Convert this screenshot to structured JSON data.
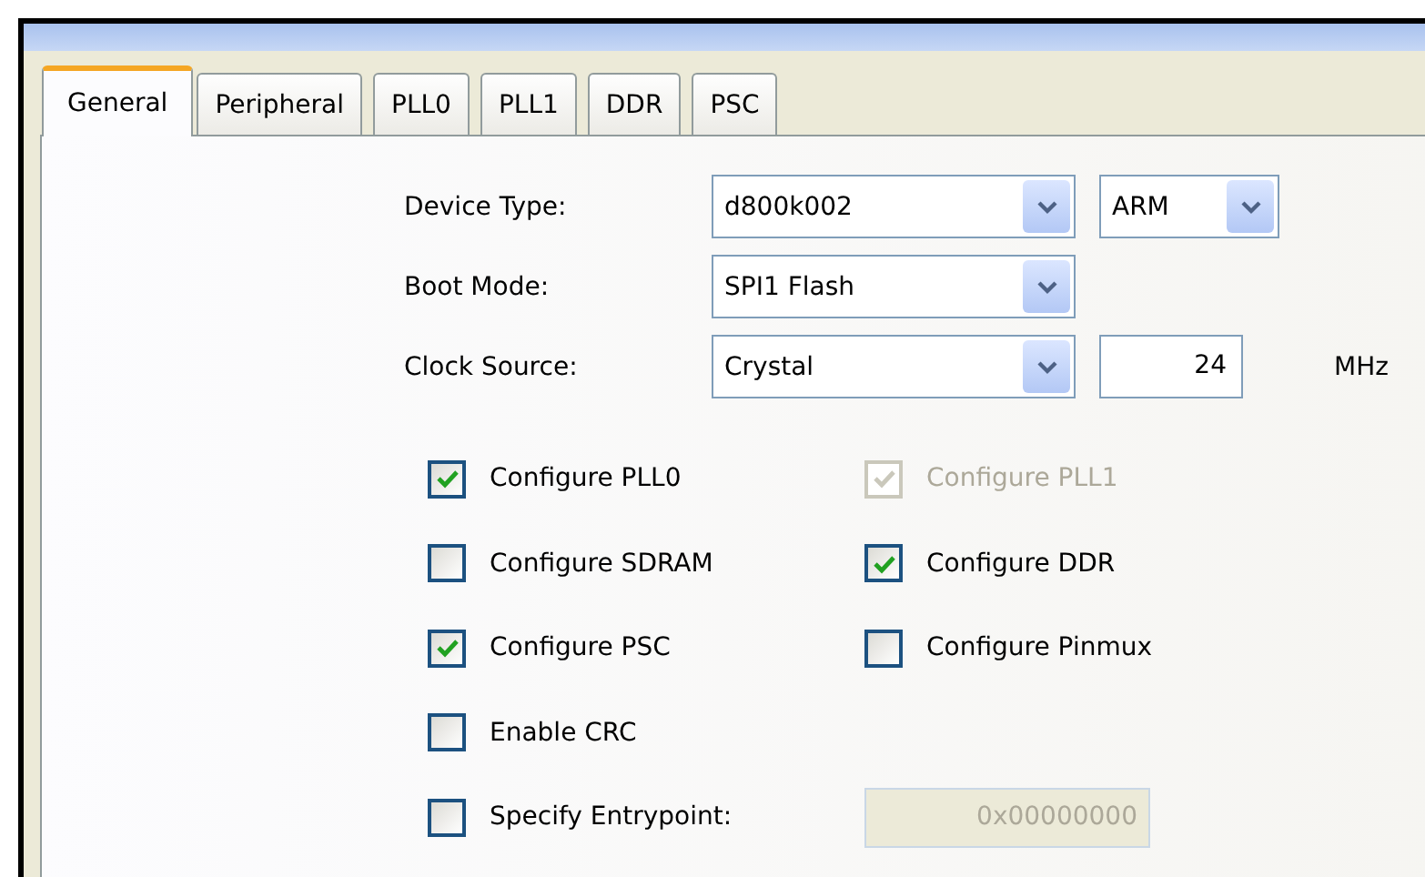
{
  "tabs": [
    {
      "label": "General",
      "selected": true
    },
    {
      "label": "Peripheral",
      "selected": false
    },
    {
      "label": "PLL0",
      "selected": false
    },
    {
      "label": "PLL1",
      "selected": false
    },
    {
      "label": "DDR",
      "selected": false
    },
    {
      "label": "PSC",
      "selected": false
    }
  ],
  "settings": [
    {
      "label": "Device Type:",
      "controls": [
        {
          "kind": "combo",
          "value": "d800k002"
        },
        {
          "kind": "combo",
          "value": "ARM"
        }
      ]
    },
    {
      "label": "Boot Mode:",
      "controls": [
        {
          "kind": "combo",
          "value": "SPI1 Flash"
        }
      ]
    },
    {
      "label": "Clock Source:",
      "controls": [
        {
          "kind": "combo",
          "value": "Crystal"
        },
        {
          "kind": "number",
          "value": "24"
        },
        {
          "kind": "unit",
          "value": "MHz"
        }
      ]
    }
  ],
  "option_rows": [
    [
      {
        "kind": "checkbox",
        "label": "Configure PLL0",
        "checked": true,
        "disabled": false
      },
      {
        "kind": "checkbox",
        "label": "Configure PLL1",
        "checked": true,
        "disabled": true
      }
    ],
    [
      {
        "kind": "checkbox",
        "label": "Configure SDRAM",
        "checked": false,
        "disabled": false
      },
      {
        "kind": "checkbox",
        "label": "Configure DDR",
        "checked": true,
        "disabled": false
      }
    ],
    [
      {
        "kind": "checkbox",
        "label": "Configure PSC",
        "checked": true,
        "disabled": false
      },
      {
        "kind": "checkbox",
        "label": "Configure Pinmux",
        "checked": false,
        "disabled": false
      }
    ],
    [
      {
        "kind": "checkbox",
        "label": "Enable CRC",
        "checked": false,
        "disabled": false
      }
    ],
    [
      {
        "kind": "checkbox",
        "label": "Specify Entrypoint:",
        "checked": false,
        "disabled": false
      },
      {
        "kind": "field",
        "value": "0x00000000",
        "disabled": true
      }
    ]
  ]
}
